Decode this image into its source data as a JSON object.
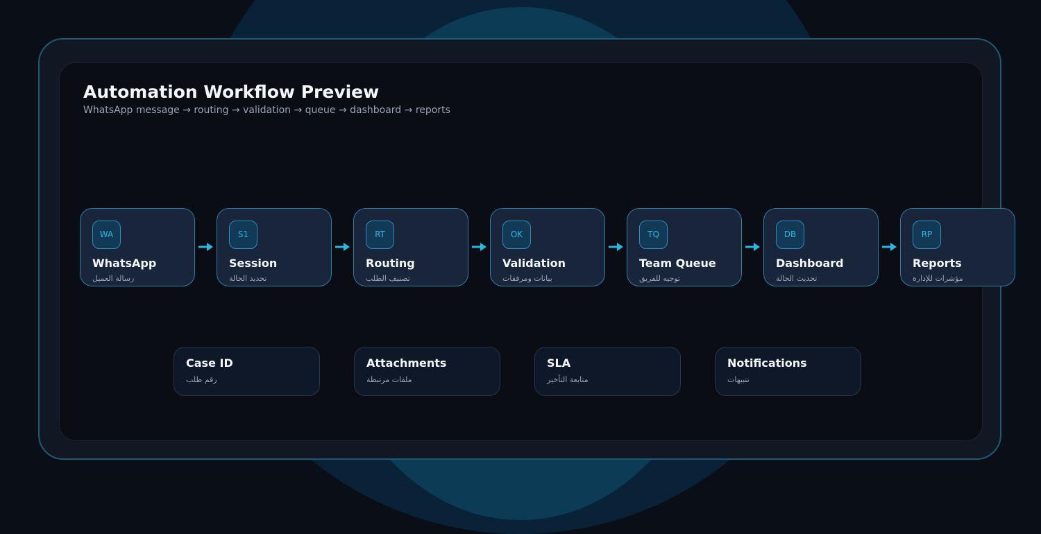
{
  "header": {
    "title": "Automation Workflow Preview",
    "subtitle": "WhatsApp message → routing → validation → queue → dashboard → reports"
  },
  "colors": {
    "accent": "#29b6e0",
    "background": "#0a0e17",
    "panel": "#0a0d14",
    "node_fill": "#18253a",
    "node_border": "#2b7fa8"
  },
  "steps": [
    {
      "badge": "WA",
      "label": "WhatsApp",
      "label_ar": "رسالة العميل"
    },
    {
      "badge": "S1",
      "label": "Session",
      "label_ar": "تحديد الحالة"
    },
    {
      "badge": "RT",
      "label": "Routing",
      "label_ar": "تصنيف الطلب"
    },
    {
      "badge": "OK",
      "label": "Validation",
      "label_ar": "بيانات ومرفقات"
    },
    {
      "badge": "TQ",
      "label": "Team Queue",
      "label_ar": "توجيه للفريق"
    },
    {
      "badge": "DB",
      "label": "Dashboard",
      "label_ar": "تحديث الحالة"
    },
    {
      "badge": "RP",
      "label": "Reports",
      "label_ar": "مؤشرات للإدارة"
    }
  ],
  "features": [
    {
      "label": "Case ID",
      "label_ar": "رقم طلب"
    },
    {
      "label": "Attachments",
      "label_ar": "ملفات مرتبطة"
    },
    {
      "label": "SLA",
      "label_ar": "متابعة التأخير"
    },
    {
      "label": "Notifications",
      "label_ar": "تنبيهات"
    }
  ]
}
